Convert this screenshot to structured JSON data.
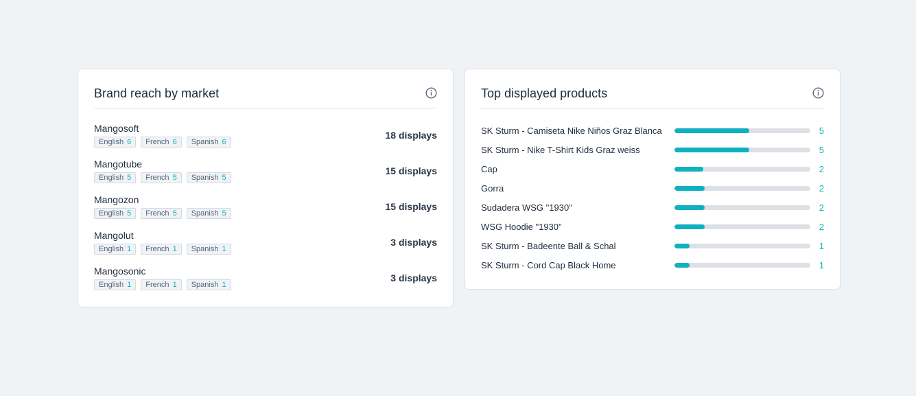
{
  "colors": {
    "accent": "#0fb1c0",
    "background": "#f0f3f6",
    "card": "#ffffff",
    "bar_track": "#dde1e6"
  },
  "brand_card": {
    "title": "Brand reach by market",
    "info_icon": "info-circle-icon",
    "brands": [
      {
        "name": "Mangosoft",
        "displays": "18 displays",
        "tags": [
          {
            "label": "English",
            "count": "6"
          },
          {
            "label": "French",
            "count": "6"
          },
          {
            "label": "Spanish",
            "count": "6"
          }
        ]
      },
      {
        "name": "Mangotube",
        "displays": "15 displays",
        "tags": [
          {
            "label": "English",
            "count": "5"
          },
          {
            "label": "French",
            "count": "5"
          },
          {
            "label": "Spanish",
            "count": "5"
          }
        ]
      },
      {
        "name": "Mangozon",
        "displays": "15 displays",
        "tags": [
          {
            "label": "English",
            "count": "5"
          },
          {
            "label": "French",
            "count": "5"
          },
          {
            "label": "Spanish",
            "count": "5"
          }
        ]
      },
      {
        "name": "Mangolut",
        "displays": "3 displays",
        "tags": [
          {
            "label": "English",
            "count": "1"
          },
          {
            "label": "French",
            "count": "1"
          },
          {
            "label": "Spanish",
            "count": "1"
          }
        ]
      },
      {
        "name": "Mangosonic",
        "displays": "3 displays",
        "tags": [
          {
            "label": "English",
            "count": "1"
          },
          {
            "label": "French",
            "count": "1"
          },
          {
            "label": "Spanish",
            "count": "1"
          }
        ]
      }
    ]
  },
  "products_card": {
    "title": "Top displayed products",
    "info_icon": "info-circle-icon",
    "products": [
      {
        "name": "SK Sturm - Camiseta Nike Niños Graz Blanca",
        "count": "5",
        "fraction": 0.55
      },
      {
        "name": "SK Sturm - Nike T-Shirt Kids Graz weiss",
        "count": "5",
        "fraction": 0.55
      },
      {
        "name": "Cap",
        "count": "2",
        "fraction": 0.21
      },
      {
        "name": "Gorra",
        "count": "2",
        "fraction": 0.22
      },
      {
        "name": "Sudadera WSG \"1930\"",
        "count": "2",
        "fraction": 0.22
      },
      {
        "name": "WSG Hoodie \"1930\"",
        "count": "2",
        "fraction": 0.22
      },
      {
        "name": "SK Sturm - Badeente Ball & Schal",
        "count": "1",
        "fraction": 0.11
      },
      {
        "name": "SK Sturm - Cord Cap Black Home",
        "count": "1",
        "fraction": 0.11
      }
    ]
  }
}
